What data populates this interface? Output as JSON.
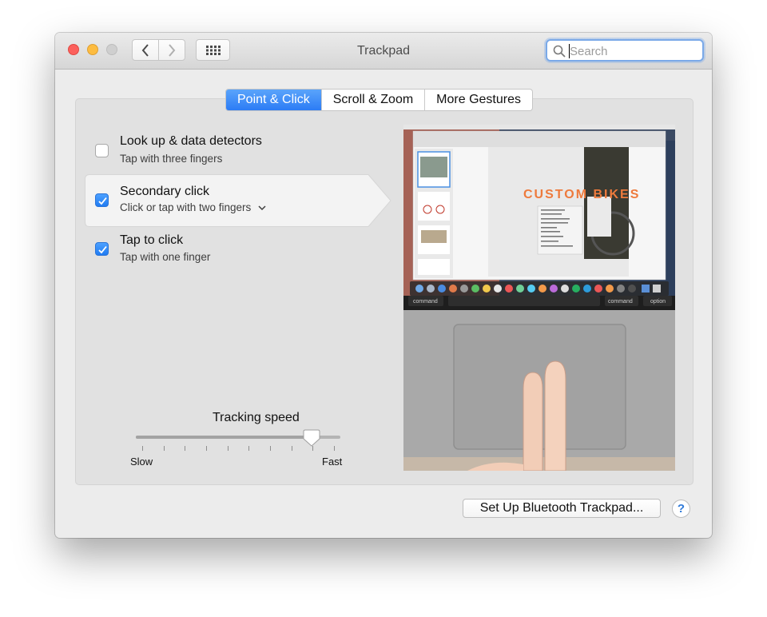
{
  "window": {
    "title": "Trackpad"
  },
  "toolbar": {
    "back_icon": "chevron-left-icon",
    "forward_icon": "chevron-right-icon",
    "grid_icon": "grid-icon"
  },
  "search": {
    "placeholder": "Search",
    "icon": "search-icon"
  },
  "tabs": [
    {
      "label": "Point & Click",
      "active": true
    },
    {
      "label": "Scroll & Zoom",
      "active": false
    },
    {
      "label": "More Gestures",
      "active": false
    }
  ],
  "options": [
    {
      "title": "Look up & data detectors",
      "subtitle": "Tap with three fingers",
      "checked": false
    },
    {
      "title": "Secondary click",
      "subtitle": "Click or tap with two fingers",
      "checked": true,
      "has_dropdown": true
    },
    {
      "title": "Tap to click",
      "subtitle": "Tap with one finger",
      "checked": true
    }
  ],
  "tracking": {
    "label": "Tracking speed",
    "min_label": "Slow",
    "max_label": "Fast",
    "value_fraction": 0.86,
    "tick_count": 10
  },
  "preview": {
    "headline": "CUSTOM BIKES",
    "key_left": "command",
    "key_right_1": "command",
    "key_right_2": "option"
  },
  "footer": {
    "bluetooth_button": "Set Up Bluetooth Trackpad...",
    "help": "?"
  },
  "colors": {
    "accent": "#2c7cf5",
    "close": "#fc605c",
    "minimize": "#fdbc40",
    "zoom_disabled": "#cfcfcf"
  }
}
